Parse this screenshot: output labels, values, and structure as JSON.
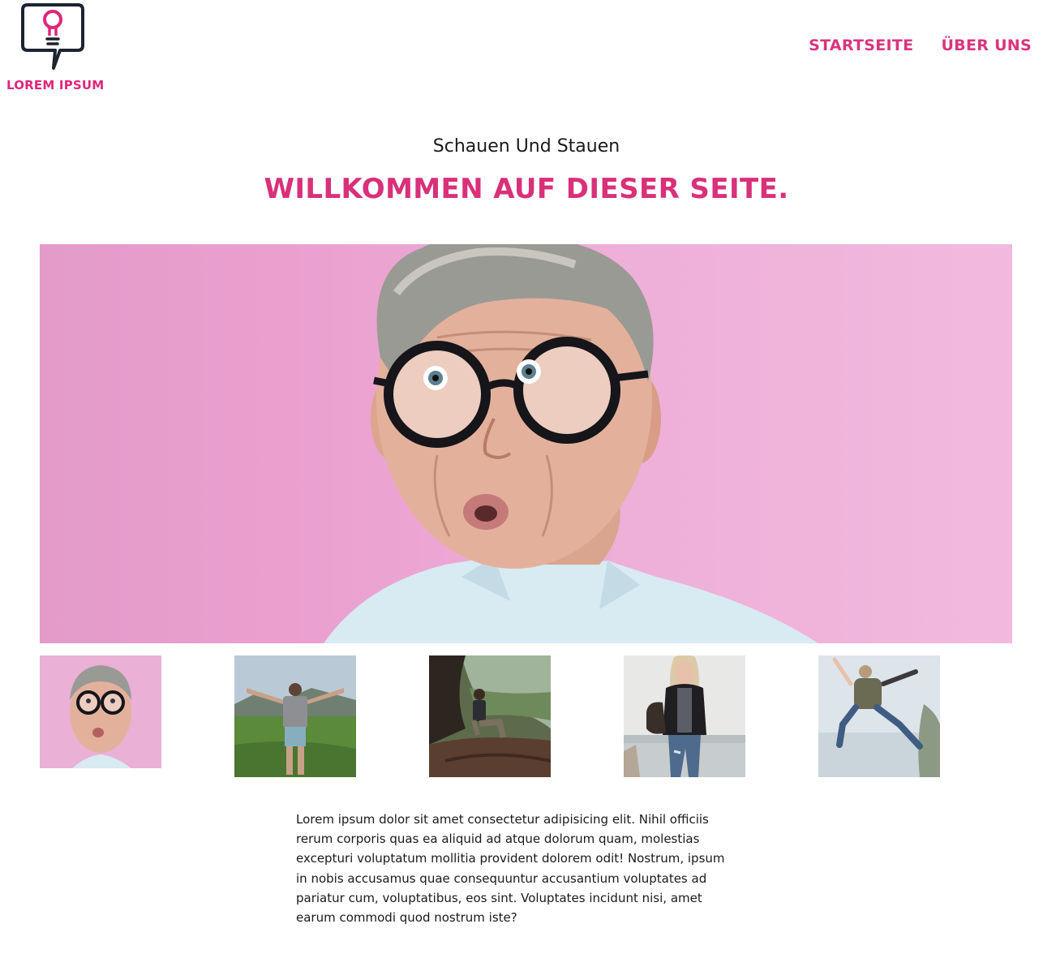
{
  "brand": {
    "name": "LOREM IPSUM",
    "logo_icon": "lightbulb-speech-bubble-icon",
    "accent": "#e0267a",
    "dark": "#1b2430"
  },
  "nav": {
    "items": [
      {
        "label": "STARTSEITE"
      },
      {
        "label": "ÜBER UNS"
      }
    ]
  },
  "hero": {
    "subtitle": "Schauen Und Stauen",
    "headline": "WILLKOMMEN AUF DIESER SEITE.",
    "background": "#eeaad6"
  },
  "gallery": {
    "thumbnails": [
      {
        "name": "thumb-surprised-man"
      },
      {
        "name": "thumb-man-arms-spread"
      },
      {
        "name": "thumb-man-sitting-cliff"
      },
      {
        "name": "thumb-woman-walking-beach"
      },
      {
        "name": "thumb-person-jumping"
      }
    ]
  },
  "content": {
    "paragraph": "Lorem ipsum dolor sit amet consectetur adipisicing elit. Nihil officiis rerum corporis quas ea aliquid ad atque dolorum quam, molestias excepturi voluptatum mollitia provident dolorem odit! Nostrum, ipsum in nobis accusamus quae consequuntur accusantium voluptates ad pariatur cum, voluptatibus, eos sint. Voluptates incidunt nisi, amet earum commodi quod nostrum iste?"
  }
}
